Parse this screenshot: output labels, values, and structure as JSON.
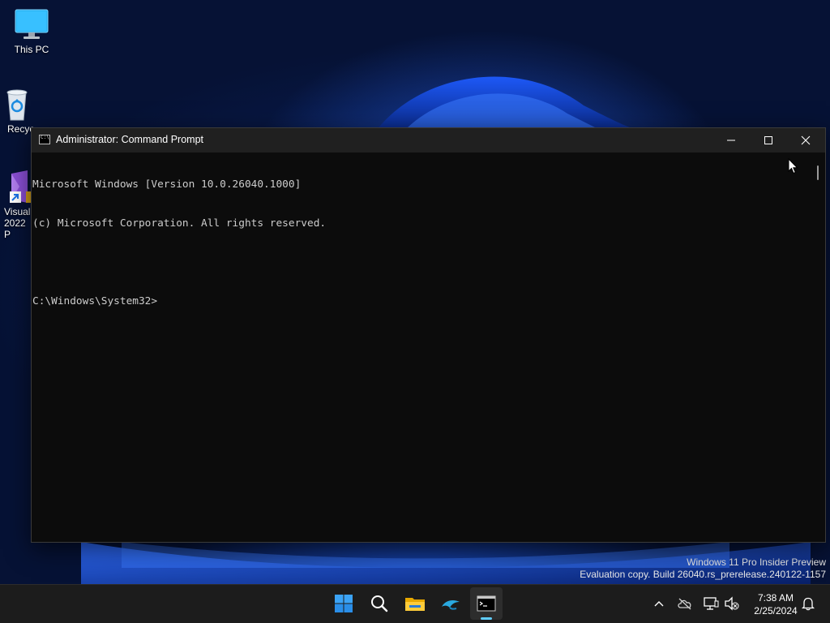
{
  "desktop": {
    "icons": [
      {
        "label": "This PC"
      },
      {
        "label": "Recyc"
      },
      {
        "label_line1": "Visual",
        "label_line2": "2022 P"
      }
    ]
  },
  "window": {
    "title": "Administrator: Command Prompt",
    "title_icon_text": "C:\\",
    "console_lines": [
      "Microsoft Windows [Version 10.0.26040.1000]",
      "(c) Microsoft Corporation. All rights reserved.",
      "",
      "C:\\Windows\\System32>"
    ]
  },
  "watermark": {
    "line1": "Windows 11 Pro Insider Preview",
    "line2": "Evaluation copy. Build 26040.rs_prerelease.240122-1157"
  },
  "taskbar": {
    "apps": [
      "start-icon",
      "search-icon",
      "file-explorer-icon",
      "dolphin-app-icon",
      "command-prompt-icon"
    ],
    "active_app": "command-prompt-icon",
    "accent_color": "#60cdff"
  },
  "tray": {
    "time": "7:38 AM",
    "date": "2/25/2024"
  }
}
